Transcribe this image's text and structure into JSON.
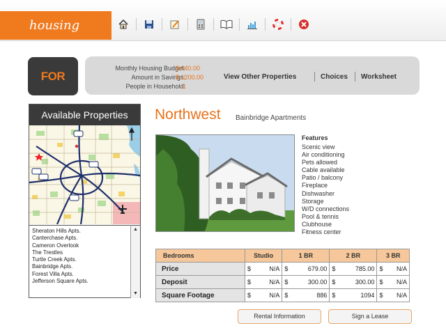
{
  "brand": {
    "name": "housing"
  },
  "toolbar": {
    "tools": [
      {
        "icon": "home-icon"
      },
      {
        "icon": "save-icon"
      },
      {
        "icon": "notepad-icon"
      },
      {
        "icon": "calculator-icon"
      },
      {
        "icon": "book-icon"
      },
      {
        "icon": "chart-icon"
      },
      {
        "icon": "help-icon"
      },
      {
        "icon": "close-icon"
      }
    ]
  },
  "for_rent_sign": "FOR RENT",
  "budget": {
    "monthly_label": "Monthly Housing Budget:",
    "monthly_value": "$ 640.00",
    "savings_label": "Amount in Savings:",
    "savings_value": "$ 1200.00",
    "people_label": "People in Household:",
    "people_value": "1"
  },
  "nav": {
    "view_other": "View Other Properties",
    "choices": "Choices",
    "worksheet": "Worksheet"
  },
  "available": {
    "title": "Available Properties",
    "items": [
      "Sheraton Hills Apts.",
      "Canterchase Apts.",
      "Cameron Overlook",
      "The Trestles",
      "Turtle Creek Apts.",
      "Bainbridge Apts.",
      "Forest Villa Apts.",
      "Jefferson Square Apts."
    ]
  },
  "property": {
    "region": "Northwest",
    "name": "Bainbridge Apartments",
    "features_title": "Features",
    "features": [
      "Scenic view",
      "Air conditioning",
      "Pets allowed",
      "Cable available",
      "Patio / balcony",
      "Fireplace",
      "Dishwasher",
      "Storage",
      "W/D connections",
      "Pool & tennis",
      "Clubhouse",
      "Fitness center"
    ]
  },
  "rates": {
    "headers": [
      "Bedrooms",
      "Studio",
      "1 BR",
      "2 BR",
      "3 BR"
    ],
    "rows": [
      {
        "label": "Price",
        "cells": [
          [
            "$",
            "N/A"
          ],
          [
            "$",
            "679.00"
          ],
          [
            "$",
            "785.00"
          ],
          [
            "$",
            "N/A"
          ]
        ]
      },
      {
        "label": "Deposit",
        "cells": [
          [
            "$",
            "N/A"
          ],
          [
            "$",
            "300.00"
          ],
          [
            "$",
            "300.00"
          ],
          [
            "$",
            "N/A"
          ]
        ]
      },
      {
        "label": "Square Footage",
        "cells": [
          [
            "$",
            "N/A"
          ],
          [
            "$",
            "886"
          ],
          [
            "$",
            "1094"
          ],
          [
            "$",
            "N/A"
          ]
        ]
      }
    ]
  },
  "buttons": {
    "rental_info": "Rental Information",
    "sign_lease": "Sign a Lease"
  },
  "colors": {
    "accent": "#f07a1e",
    "dark": "#3a3a3a",
    "panel": "#d9d9d9",
    "table_header": "#f5c79a"
  }
}
